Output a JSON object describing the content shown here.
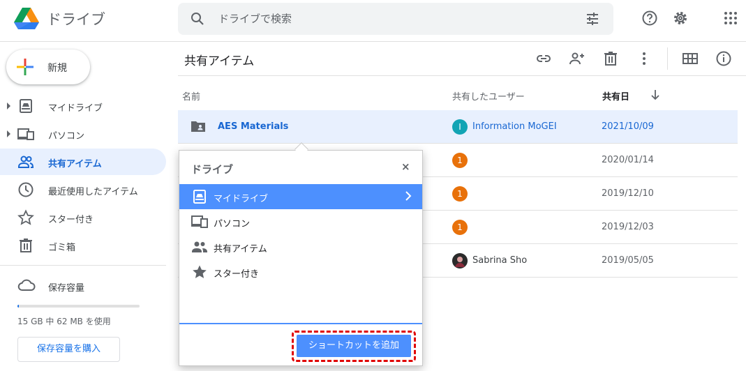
{
  "header": {
    "app_name": "ドライブ",
    "search_placeholder": "ドライブで検索"
  },
  "sidebar": {
    "new_label": "新規",
    "items": [
      {
        "label": "マイドライブ",
        "icon": "drive-icon"
      },
      {
        "label": "パソコン",
        "icon": "computer-icon"
      },
      {
        "label": "共有アイテム",
        "icon": "shared-icon",
        "active": true
      },
      {
        "label": "最近使用したアイテム",
        "icon": "clock-icon"
      },
      {
        "label": "スター付き",
        "icon": "star-icon"
      },
      {
        "label": "ゴミ箱",
        "icon": "trash-icon"
      }
    ],
    "storage_label": "保存容量",
    "storage_text": "15 GB 中 62 MB を使用",
    "storage_used_fraction": 0.004,
    "buy_label": "保存容量を購入"
  },
  "main": {
    "title": "共有アイテム",
    "columns": {
      "name": "名前",
      "shared_by": "共有したユーザー",
      "date": "共有日"
    },
    "rows": [
      {
        "name": "AES Materials",
        "avatar": "I",
        "user": "Information MoGEI",
        "date": "2021/10/09"
      },
      {
        "name": "",
        "avatar": "1",
        "user": "",
        "date": "2020/01/14"
      },
      {
        "name": "",
        "avatar": "1",
        "user": "",
        "date": "2019/12/10"
      },
      {
        "name": "",
        "avatar": "1",
        "user": "",
        "date": "2019/12/03"
      },
      {
        "name": "",
        "avatar": "",
        "user": "Sabrina Sho",
        "date": "2019/05/05"
      }
    ]
  },
  "popup": {
    "title": "ドライブ",
    "close": "×",
    "items": [
      {
        "label": "マイドライブ"
      },
      {
        "label": "パソコン"
      },
      {
        "label": "共有アイテム"
      },
      {
        "label": "スター付き"
      }
    ],
    "add_button": "ショートカットを追加"
  },
  "colors": {
    "accent": "#1a73e8",
    "selected_bg": "#e8f0fe",
    "popup_select": "#4d90fe",
    "avatar_teal": "#12a4b4",
    "avatar_orange": "#e8710a",
    "highlight": "#e00000"
  }
}
